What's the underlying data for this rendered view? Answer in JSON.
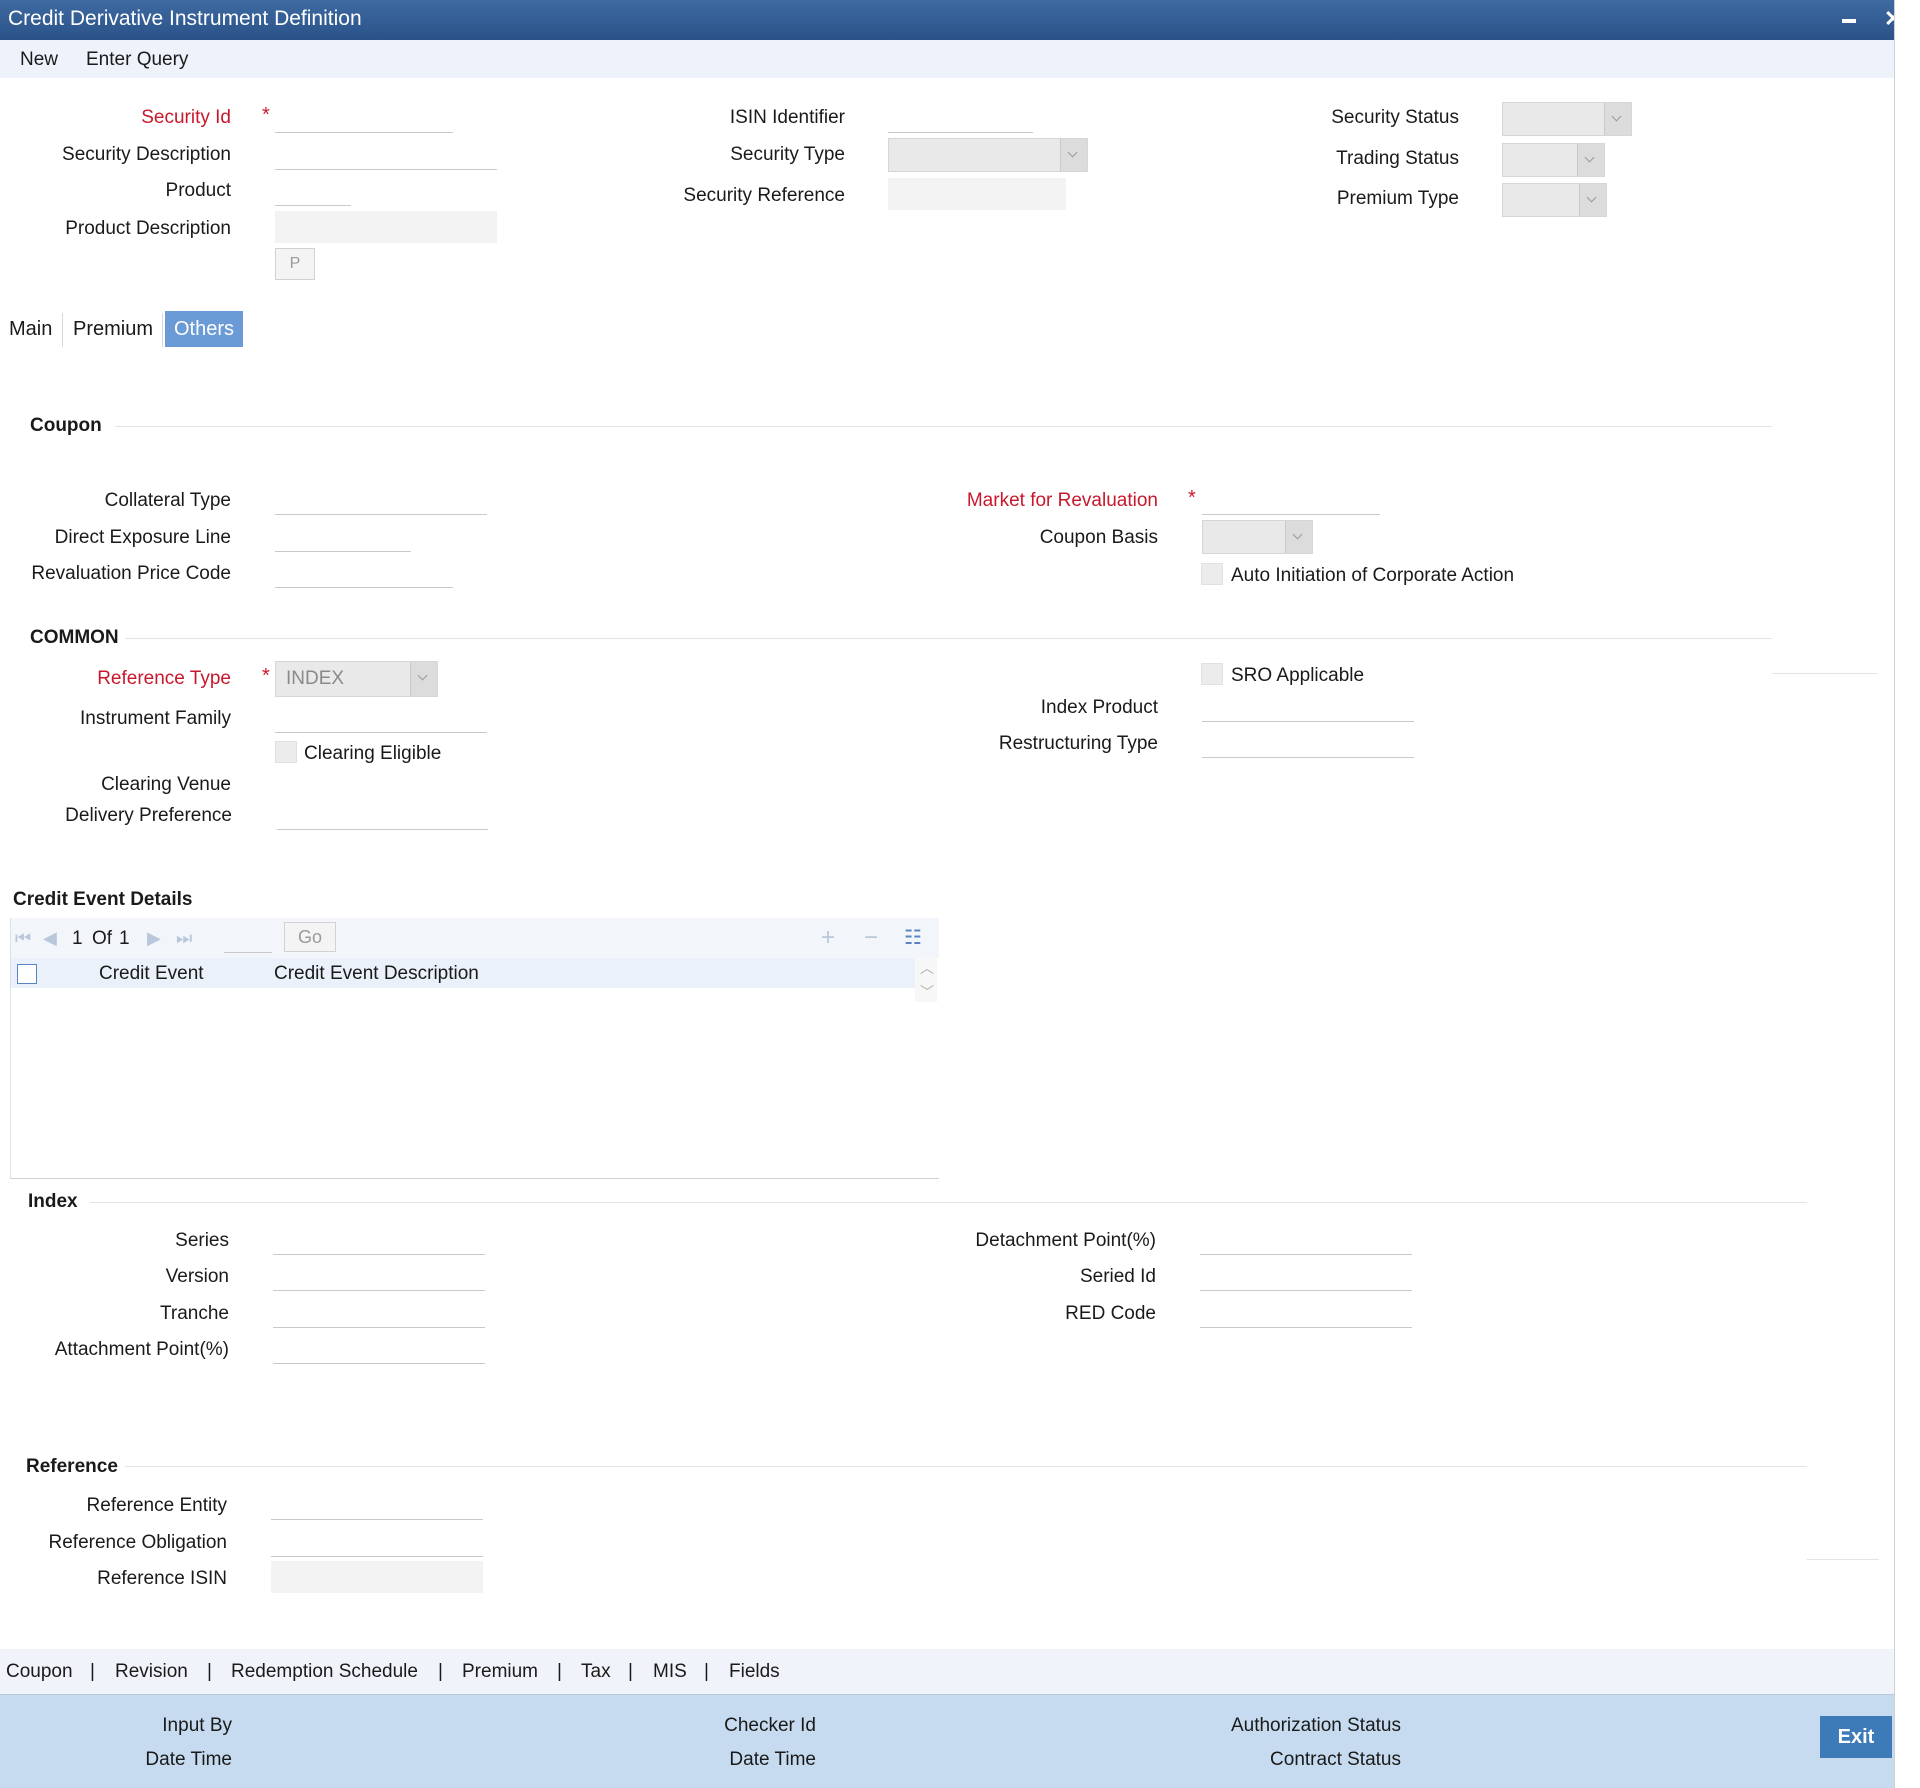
{
  "window": {
    "title": "Credit Derivative Instrument Definition"
  },
  "menu": {
    "new": "New",
    "enter_query": "Enter Query"
  },
  "header": {
    "security_id": "Security Id",
    "security_description": "Security Description",
    "product": "Product",
    "product_description": "Product Description",
    "p_button": "P",
    "isin_identifier": "ISIN Identifier",
    "security_type": "Security Type",
    "security_reference": "Security Reference",
    "security_status": "Security Status",
    "trading_status": "Trading Status",
    "premium_type": "Premium Type"
  },
  "tabs": {
    "main": "Main",
    "premium": "Premium",
    "others": "Others"
  },
  "coupon": {
    "title": "Coupon",
    "collateral_type": "Collateral Type",
    "direct_exposure_line": "Direct Exposure Line",
    "revaluation_price_code": "Revaluation Price Code",
    "market_for_revaluation": "Market for Revaluation",
    "coupon_basis": "Coupon Basis",
    "auto_initiation": "Auto Initiation of Corporate Action"
  },
  "common": {
    "title": "COMMON",
    "reference_type": "Reference Type",
    "reference_type_value": "INDEX",
    "instrument_family": "Instrument Family",
    "clearing_eligible": "Clearing Eligible",
    "clearing_venue": "Clearing Venue",
    "delivery_preference": "Delivery Preference",
    "sro_applicable": "SRO Applicable",
    "index_product": "Index Product",
    "restructuring_type": "Restructuring Type"
  },
  "credit_event": {
    "title": "Credit Event Details",
    "page_current": "1",
    "page_of": "Of",
    "page_total": "1",
    "go": "Go",
    "col_event": "Credit Event",
    "col_description": "Credit Event Description"
  },
  "index": {
    "title": "Index",
    "series": "Series",
    "version": "Version",
    "tranche": "Tranche",
    "attachment_point": "Attachment Point(%)",
    "detachment_point": "Detachment Point(%)",
    "seried_id": "Seried Id",
    "red_code": "RED Code"
  },
  "reference": {
    "title": "Reference",
    "reference_entity": "Reference Entity",
    "reference_obligation": "Reference Obligation",
    "reference_isin": "Reference ISIN"
  },
  "bottom_links": [
    "Coupon",
    "Revision",
    "Redemption Schedule",
    "Premium",
    "Tax",
    "MIS",
    "Fields"
  ],
  "bottom_sep": "|",
  "footer": {
    "input_by": "Input By",
    "date_time_1": "Date Time",
    "checker_id": "Checker Id",
    "date_time_2": "Date Time",
    "authorization_status": "Authorization Status",
    "contract_status": "Contract Status",
    "exit": "Exit"
  },
  "colors": {
    "title_bar": "#2f5a92",
    "required": "#c8182c",
    "active_tab": "#6b9bd6",
    "footer": "#c6dbef"
  }
}
